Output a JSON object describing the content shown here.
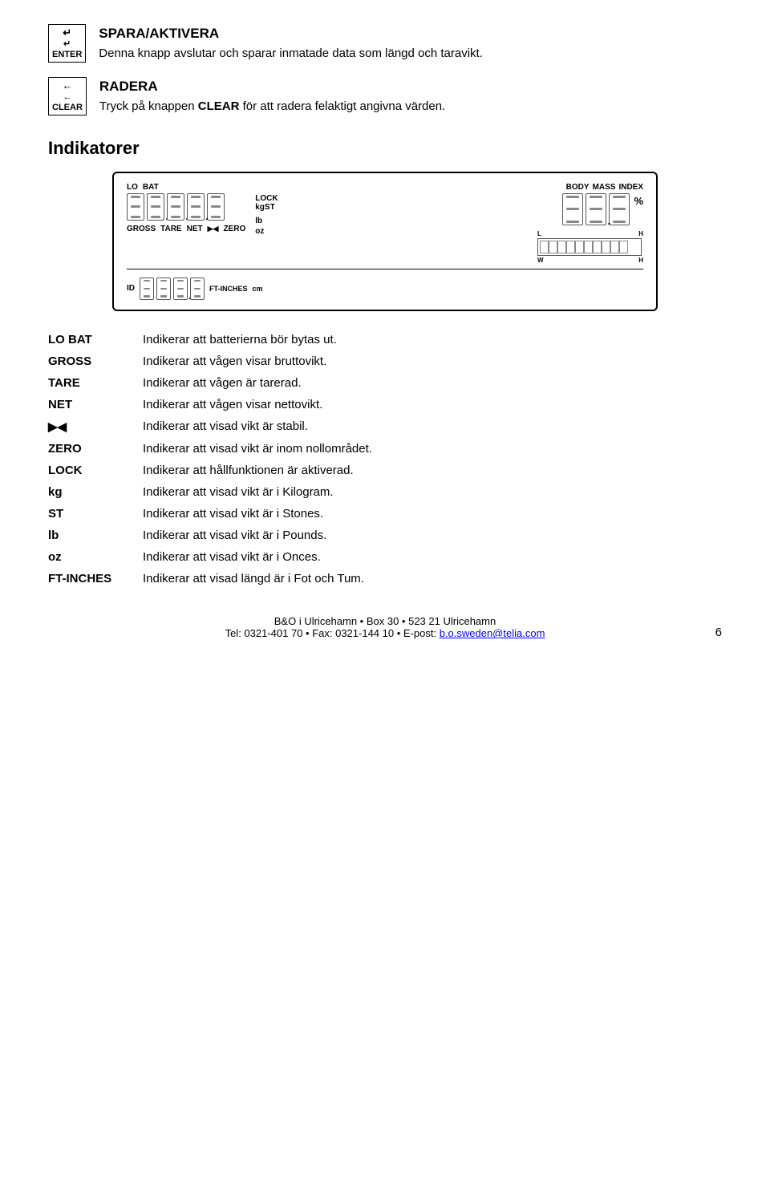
{
  "page": {
    "number": "6"
  },
  "enter_section": {
    "key_label": "ENTER",
    "heading": "SPARA/AKTIVERA",
    "description": "Denna knapp avslutar och sparar inmatade data som längd och taravikt."
  },
  "clear_section": {
    "key_label": "CLEAR",
    "heading": "RADERA",
    "description": "Tryck på knappen",
    "bold_word": "CLEAR",
    "description2": "för att radera felaktigt angivna värden."
  },
  "indikatorer": {
    "heading": "Indikatorer"
  },
  "display": {
    "top_left_labels": [
      "LO",
      "BAT"
    ],
    "lock_label": "LOCK",
    "kgst_label": "kgST",
    "lb_label": "lb",
    "oz_label": "oz",
    "percent_label": "%",
    "gross_label": "GROSS",
    "tare_label": "TARE",
    "net_label": "NET",
    "zero_label": "ZERO",
    "body_mass_index_labels": [
      "BODY",
      "MASS",
      "INDEX"
    ],
    "ft_inches_label": "FT-INCHES",
    "id_label": "ID",
    "cm_label": "cm",
    "low_label": "L",
    "high_label": "H",
    "low_w_label": "W",
    "high_h_label": "H"
  },
  "indicators": [
    {
      "term": "LO BAT",
      "desc": "Indikerar att batterierna bör bytas ut."
    },
    {
      "term": "GROSS",
      "desc": "Indikerar att vågen visar bruttovikt."
    },
    {
      "term": "TARE",
      "desc": "Indikerar att vågen är tarerad."
    },
    {
      "term": "NET",
      "desc": "Indikerar att vågen visar nettovikt."
    },
    {
      "term": "▶◀",
      "desc": "Indikerar att visad vikt är stabil."
    },
    {
      "term": "ZERO",
      "desc": "Indikerar att visad vikt är inom nollområdet."
    },
    {
      "term": "LOCK",
      "desc": "Indikerar att hållfunktionen är aktiverad."
    },
    {
      "term": "kg",
      "desc": "Indikerar att visad vikt är i Kilogram."
    },
    {
      "term": "ST",
      "desc": "Indikerar att visad vikt är i Stones."
    },
    {
      "term": "lb",
      "desc": "Indikerar att visad vikt är i Pounds."
    },
    {
      "term": "oz",
      "desc": "Indikerar att visad vikt är i Onces."
    },
    {
      "term": "FT-INCHES",
      "desc": "Indikerar att visad längd är i Fot och Tum."
    }
  ],
  "footer": {
    "line1": "B&O i Ulricehamn  •  Box 30  •  523 21 Ulricehamn",
    "line2_pre": "Tel: 0321-401 70  •  Fax: 0321-144 10  •  E-post: ",
    "email": "b.o.sweden@telia.com",
    "email_href": "mailto:b.o.sweden@telia.com"
  }
}
